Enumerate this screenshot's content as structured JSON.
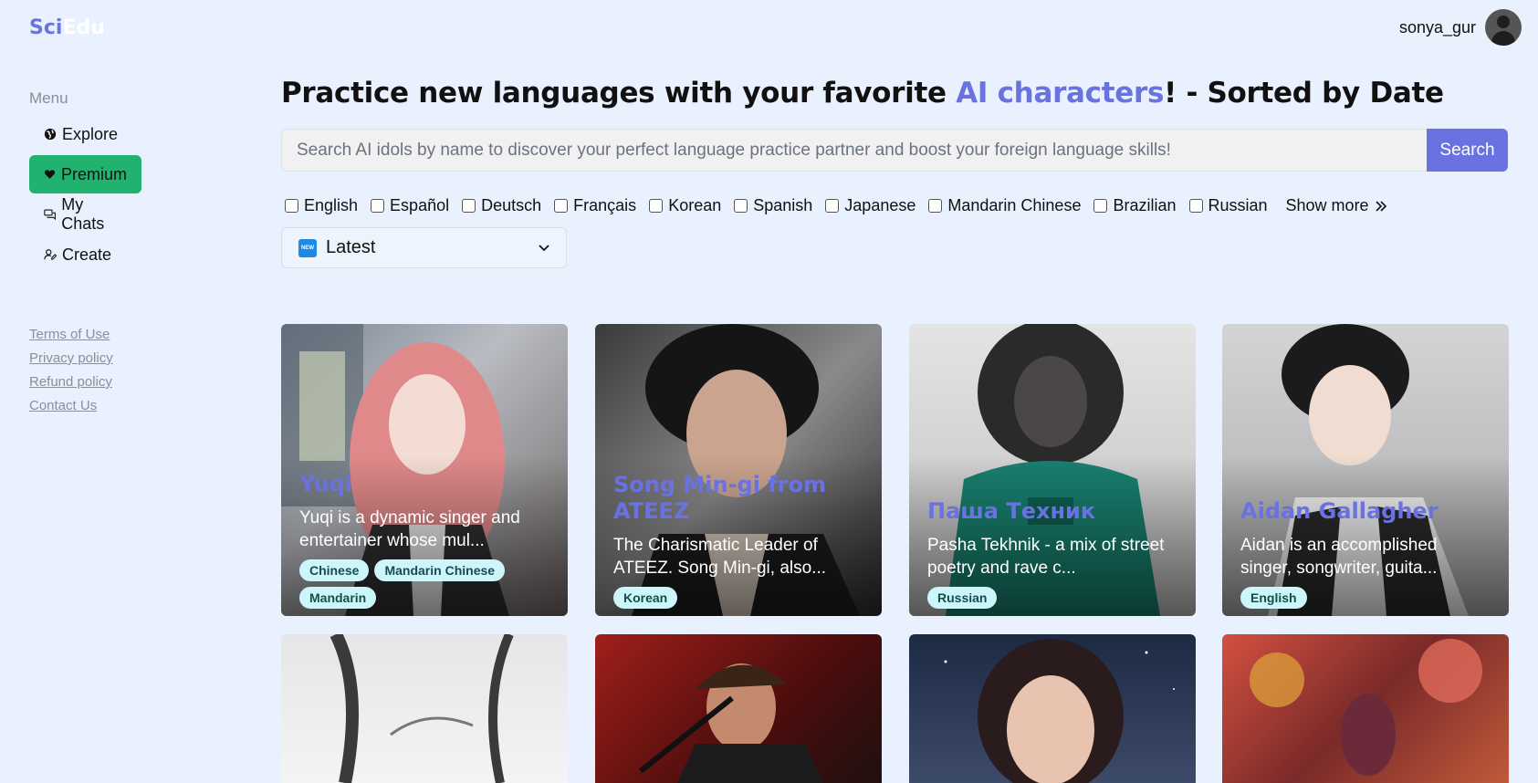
{
  "brand": {
    "part1": "Sci",
    "part2": "Edu"
  },
  "user": {
    "name": "sonya_gur"
  },
  "sidebar": {
    "menu_label": "Menu",
    "items": [
      {
        "label": "Explore",
        "icon": "globe-icon"
      },
      {
        "label": "Premium",
        "icon": "heart-icon",
        "active": true
      },
      {
        "label": "My Chats",
        "icon": "chat-icon"
      },
      {
        "label": "Create",
        "icon": "create-icon"
      }
    ],
    "footer": [
      "Terms of Use",
      "Privacy policy",
      "Refund policy",
      "Contact Us"
    ]
  },
  "headline": {
    "before": "Practice new languages with your favorite ",
    "highlight": "AI characters",
    "after": "! - Sorted by Date"
  },
  "search": {
    "placeholder": "Search AI idols by name to discover your perfect language practice partner and boost your foreign language skills!",
    "button": "Search"
  },
  "languages": [
    "English",
    "Español",
    "Deutsch",
    "Français",
    "Korean",
    "Spanish",
    "Japanese",
    "Mandarin Chinese",
    "Brazilian",
    "Russian"
  ],
  "show_more": "Show more",
  "sort": {
    "selected": "Latest",
    "badge": "NEW"
  },
  "cards": [
    {
      "name": "Yuqi",
      "desc": "Yuqi is a dynamic singer and entertainer whose mul...",
      "tags": [
        "Chinese",
        "Mandarin Chinese",
        "Mandarin"
      ]
    },
    {
      "name": "Song Min-gi from ATEEZ",
      "desc": "The Charismatic Leader of ATEEZ. Song Min-gi, also...",
      "tags": [
        "Korean"
      ]
    },
    {
      "name": "Паша Техник",
      "desc": "Pasha Tekhnik - a mix of street poetry and rave c...",
      "tags": [
        "Russian"
      ]
    },
    {
      "name": "Aidan Gallagher",
      "desc": "Aidan is an accomplished singer, songwriter, guita...",
      "tags": [
        "English"
      ]
    }
  ],
  "colors": {
    "accent": "#6a72e2",
    "premium": "#21b26f",
    "background": "#e8f1fd",
    "tag_bg": "#cdf6fb"
  }
}
